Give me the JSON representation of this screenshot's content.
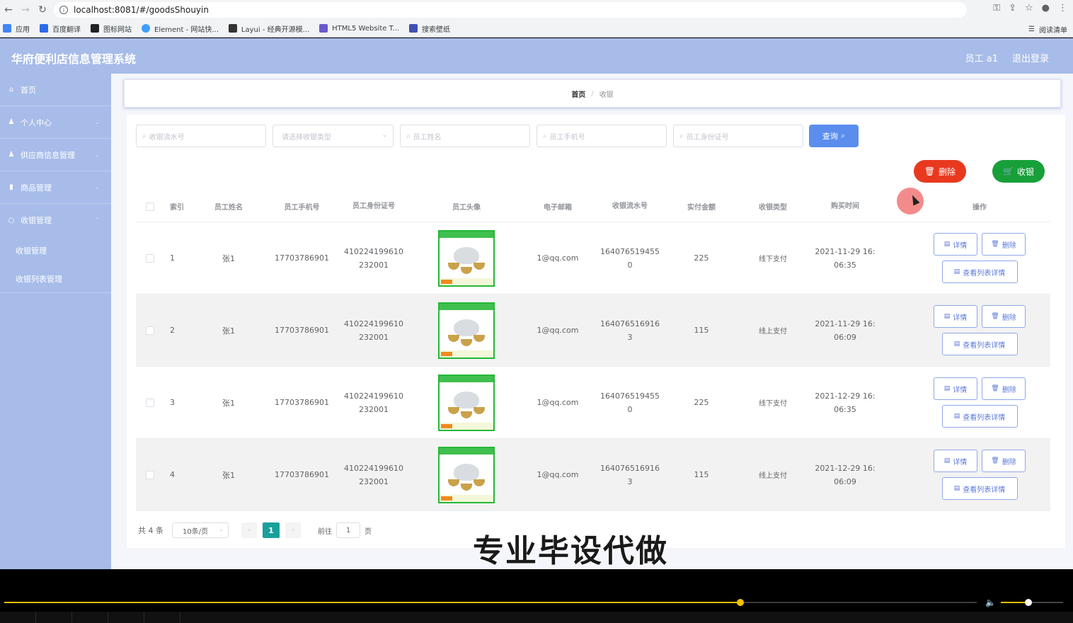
{
  "browser": {
    "url": "localhost:8081/#/goodsShouyin",
    "bookmarks": [
      {
        "label": "应用",
        "color": "#4285f4"
      },
      {
        "label": "百度翻译",
        "color": "#2b6be8"
      },
      {
        "label": "图标网站",
        "color": "#222222"
      },
      {
        "label": "Element - 网站快...",
        "color": "#409eff"
      },
      {
        "label": "Layui - 经典开源模...",
        "color": "#333333"
      },
      {
        "label": "HTML5 Website T...",
        "color": "#6a5acd"
      },
      {
        "label": "搜索壁纸",
        "color": "#3f51b5"
      }
    ],
    "reading_list": "阅读清单"
  },
  "app": {
    "title": "华府便利店信息管理系统",
    "user": "员工 a1",
    "logout": "退出登录",
    "header_color": "#a7bce9"
  },
  "sidebar": {
    "items": [
      {
        "label": "首页",
        "icon": "home-icon"
      },
      {
        "label": "个人中心",
        "icon": "user-icon"
      },
      {
        "label": "供应商信息管理",
        "icon": "user-icon"
      },
      {
        "label": "商品管理",
        "icon": "chart-icon"
      },
      {
        "label": "收银管理",
        "icon": "circle-icon"
      }
    ],
    "subitems": [
      "收银管理",
      "收银列表管理"
    ]
  },
  "breadcrumb": {
    "home": "首页",
    "sep": "/",
    "current": "收银"
  },
  "search": {
    "serial_placeholder": "收银流水号",
    "type_placeholder": "请选择收银类型",
    "name_placeholder": "员工姓名",
    "phone_placeholder": "员工手机号",
    "idcard_placeholder": "员工身份证号",
    "query_label": "查询"
  },
  "actions": {
    "delete_label": "删除",
    "cash_label": "收银"
  },
  "table": {
    "headers": [
      "索引",
      "员工姓名",
      "员工手机号",
      "员工身份证号",
      "员工头像",
      "电子邮箱",
      "收银流水号",
      "实付金额",
      "收银类型",
      "购买时间",
      "操作"
    ],
    "rows": [
      {
        "idx": "1",
        "name": "张1",
        "phone": "17703786901",
        "id1": "410224199610",
        "id2": "232001",
        "mail": "1@qq.com",
        "sn1": "164076519455",
        "sn2": "0",
        "amount": "225",
        "type": "线下支付",
        "t1": "2021-11-29 16:",
        "t2": "06:35"
      },
      {
        "idx": "2",
        "name": "张1",
        "phone": "17703786901",
        "id1": "410224199610",
        "id2": "232001",
        "mail": "1@qq.com",
        "sn1": "164076516916",
        "sn2": "3",
        "amount": "115",
        "type": "线上支付",
        "t1": "2021-11-29 16:",
        "t2": "06:09"
      },
      {
        "idx": "3",
        "name": "张1",
        "phone": "17703786901",
        "id1": "410224199610",
        "id2": "232001",
        "mail": "1@qq.com",
        "sn1": "164076519455",
        "sn2": "0",
        "amount": "225",
        "type": "线下支付",
        "t1": "2021-12-29 16:",
        "t2": "06:35"
      },
      {
        "idx": "4",
        "name": "张1",
        "phone": "17703786901",
        "id1": "410224199610",
        "id2": "232001",
        "mail": "1@qq.com",
        "sn1": "164076516916",
        "sn2": "3",
        "amount": "115",
        "type": "线上支付",
        "t1": "2021-12-29 16:",
        "t2": "06:09"
      }
    ],
    "ops": {
      "detail": "详情",
      "delete": "删除",
      "list_detail": "查看列表详情"
    }
  },
  "pager": {
    "total": "共 4 条",
    "page_size": "10条/页",
    "prev": "‹",
    "current": "1",
    "next": "›",
    "goto": "前往",
    "goto_value": "1",
    "page_unit": "页"
  },
  "watermark": "专业毕设代做",
  "player": {
    "progress": 0.757,
    "volume": 0.44,
    "accent": "#f2c200"
  }
}
